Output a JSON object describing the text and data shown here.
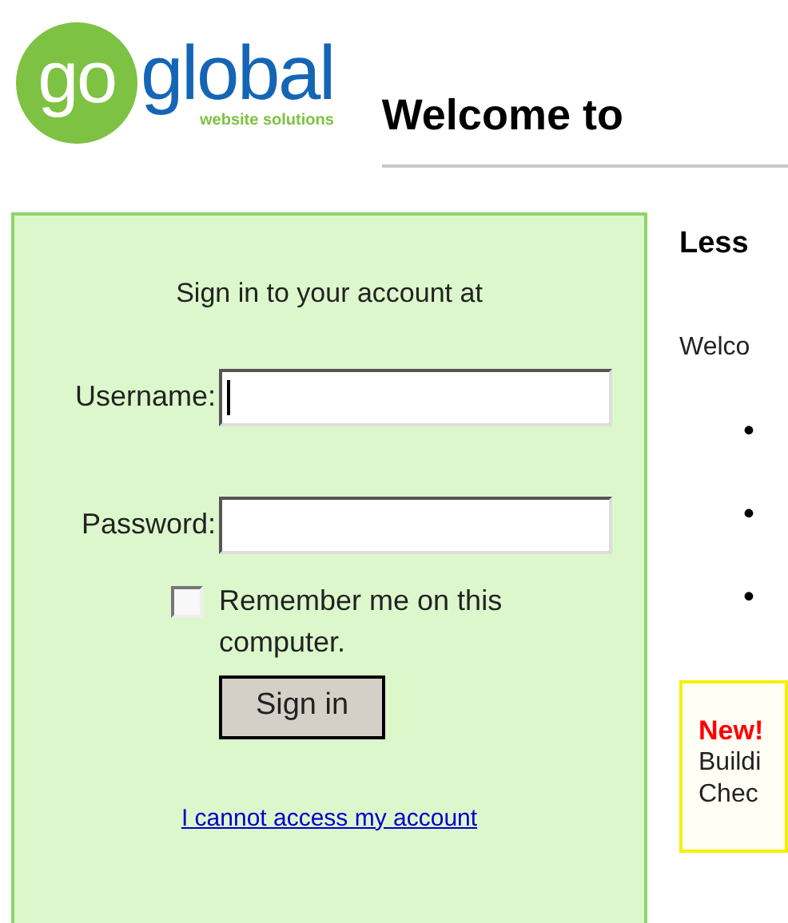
{
  "logo": {
    "mark": "go",
    "name": "global",
    "tagline": "website solutions"
  },
  "heading": "Welcome to",
  "sign_in": {
    "title": "Sign in to your account at",
    "fields": [
      {
        "label": "Username:",
        "focused": true
      },
      {
        "label": "Password:",
        "focused": false
      }
    ],
    "remember": {
      "label": "Remember me on this computer.",
      "checked": false
    },
    "button": "Sign in",
    "link": "I cannot access my account"
  },
  "content": {
    "subheading": "Less",
    "intro": "Welco",
    "bullets": [
      "•",
      "•",
      "•"
    ],
    "notice": {
      "badge": "New!",
      "lines": [
        "Buildi",
        "Chec"
      ]
    }
  }
}
